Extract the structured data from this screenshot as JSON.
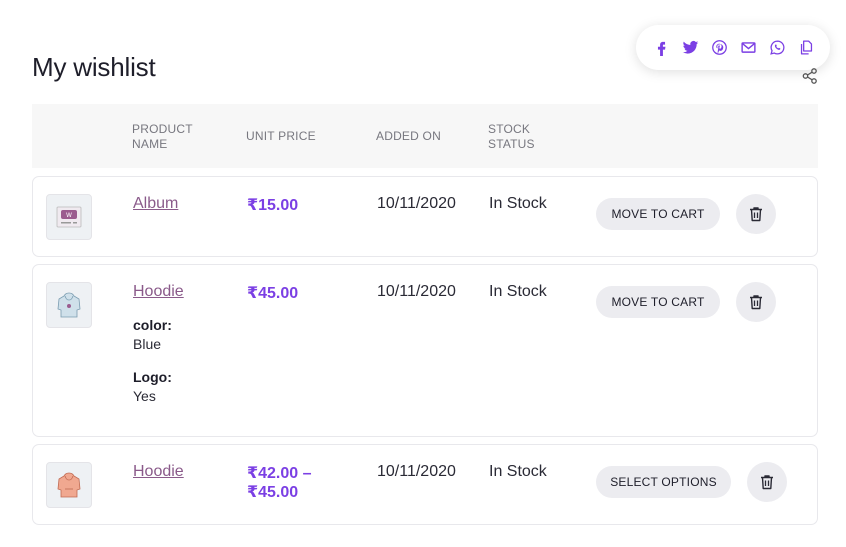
{
  "page": {
    "title": "My wishlist"
  },
  "share": {
    "icons": [
      "facebook-icon",
      "twitter-icon",
      "pinterest-icon",
      "email-icon",
      "whatsapp-icon",
      "copy-link-icon"
    ],
    "toggle_icon": "share-icon",
    "accent": "#7b3fe4"
  },
  "table": {
    "headers": {
      "product_name": "PRODUCT NAME",
      "unit_price": "UNIT PRICE",
      "added_on": "ADDED ON",
      "stock_status": "STOCK STATUS"
    },
    "rows": [
      {
        "name": "Album",
        "price": "₹15.00",
        "added_on": "10/11/2020",
        "stock": "In Stock",
        "action": "MOVE TO CART",
        "thumbnail": "album-thumbnail"
      },
      {
        "name": "Hoodie",
        "price": "₹45.00",
        "added_on": "10/11/2020",
        "stock": "In Stock",
        "action": "MOVE TO CART",
        "thumbnail": "hoodie-thumbnail",
        "attributes": [
          {
            "label": "color:",
            "value": "Blue"
          },
          {
            "label": "Logo:",
            "value": "Yes"
          }
        ]
      },
      {
        "name": "Hoodie",
        "price_line1": "₹42.00 –",
        "price_line2": "₹45.00",
        "added_on": "10/11/2020",
        "stock": "In Stock",
        "action": "SELECT OPTIONS",
        "thumbnail": "hoodie-thumbnail"
      }
    ]
  }
}
